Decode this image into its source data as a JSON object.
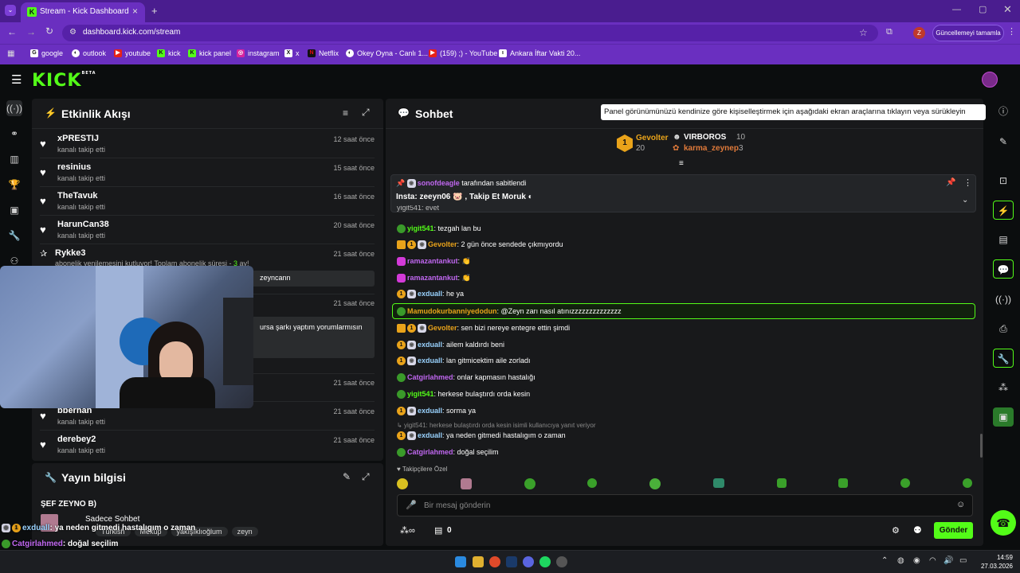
{
  "browser": {
    "tab_title": "Stream - Kick Dashboard",
    "url": "dashboard.kick.com/stream",
    "update_label": "Güncellemeyi tamamla",
    "profile_initial": "Z",
    "bookmarks": [
      "google",
      "outlook",
      "youtube",
      "kick",
      "kick panel",
      "instagram",
      "x",
      "Netflix",
      "Okey Oyna - Canlı 1...",
      "(159) ;) - YouTube",
      "Ankara İftar Vakti 20..."
    ]
  },
  "kick": {
    "logo": "KICK",
    "logo_sup": "BETA"
  },
  "activity": {
    "title": "Etkinlik Akışı",
    "rows": [
      {
        "name": "xPRESTIJ",
        "sub": "kanalı takip etti",
        "time": "12 saat önce"
      },
      {
        "name": "resinius",
        "sub": "kanalı takip etti",
        "time": "15 saat önce"
      },
      {
        "name": "TheTavuk",
        "sub": "kanalı takip etti",
        "time": "16 saat önce"
      },
      {
        "name": "HarunCan38",
        "sub": "kanalı takip etti",
        "time": "20 saat önce"
      }
    ],
    "sub_row": {
      "name": "Rykke3",
      "sub": "abonelik yenilemesini kutluyor! Toplam abonelik süresi - ",
      "months": "3",
      "months_suffix": " ay!",
      "time": "21 saat önce",
      "highlight": "zeyncann"
    },
    "hidden_row": {
      "time": "21 saat önce",
      "text": "ursa şarkı yaptım yorumlarmısın"
    },
    "row_5_time": "21 saat önce",
    "lower_rows": [
      {
        "name": "bberhan",
        "sub": "kanalı takip etti",
        "time": "21 saat önce"
      },
      {
        "name": "derebey2",
        "sub": "kanalı takip etti",
        "time": "21 saat önce"
      }
    ]
  },
  "stream_info": {
    "title": "Yayın bilgisi",
    "stream_title": "ŞEF ZEYNO B)",
    "category": "Sadece Sohbet",
    "tags": [
      "Türkish",
      "Meküp",
      "yakışıklıoğlum",
      "zeyn"
    ]
  },
  "overlay_chat": [
    {
      "user": "exduall",
      "text": ": ya neden gitmedi hastalıgım o zaman"
    },
    {
      "user": "Catgirlahmed",
      "text": ": doğal seçilim"
    }
  ],
  "chat": {
    "title": "Sohbet",
    "tooltip": "Panel görünümünüzü kendinize göre kişiselleştirmek için aşağıdaki ekran araçlarına tıklayın veya sürükleyin",
    "leaderboard": [
      {
        "rank": "1",
        "name": "Gevolter",
        "count": "20"
      },
      {
        "name": "VIRBOROS",
        "count": "10"
      },
      {
        "name": "karma_zeynep",
        "count": "3"
      }
    ],
    "pinned_by": "sonofdeagle",
    "pinned_label": "tarafından sabitlendi",
    "pinned_text": "Insta: zeeyn06",
    "pinned_text2": ", Takip Et Moruk",
    "cut_text": "yigit541: evet",
    "messages": [
      {
        "user": "yigit541",
        "color": "#53fc18",
        "text": ": tezgah lan bu"
      },
      {
        "user": "Gevolter",
        "color": "#e9a31a",
        "text": ": 2 gün önce sendede çıkmıyordu"
      },
      {
        "user": "ramazantankut",
        "color": "#c067f0",
        "text": ": 👏"
      },
      {
        "user": "ramazantankut",
        "color": "#c067f0",
        "text": ": 👏"
      },
      {
        "user": "exduall",
        "color": "#9ad3ff",
        "text": ": he ya"
      },
      {
        "user": "Mamudokurbanniyedodun",
        "color": "#e9a31a",
        "text": ": @Zeyn zarı nasıl atınızzzzzzzzzzzzzz"
      },
      {
        "user": "Gevolter",
        "color": "#e9a31a",
        "text": ": sen bizi nereye entegre ettin şimdi"
      },
      {
        "user": "exduall",
        "color": "#9ad3ff",
        "text": ": ailem kaldırdı beni"
      },
      {
        "user": "exduall",
        "color": "#9ad3ff",
        "text": ": lan gitmicektim aile zorladı"
      },
      {
        "user": "Catgirlahmed",
        "color": "#c067f0",
        "text": ": onlar kapmasın hastalığı"
      },
      {
        "user": "yigit541",
        "color": "#53fc18",
        "text": ": herkese bulaştırdı orda kesin"
      },
      {
        "user": "exduall",
        "color": "#9ad3ff",
        "text": ": sorma ya"
      },
      {
        "user": "exduall",
        "color": "#9ad3ff",
        "text": ": ya neden gitmedi hastalıgım o zaman"
      },
      {
        "user": "Catgirlahmed",
        "color": "#c067f0",
        "text": ": doğal seçilim"
      }
    ],
    "reply_hint": "yigit541: herkese bulaştırdı orda kesin isimli kullanıcıya yanıt veriyor",
    "followers_only": "Takipçilere Özel",
    "input_placeholder": "Bir mesaj gönderin",
    "points": "0",
    "send_label": "Gönder"
  },
  "taskbar": {
    "time": "14:59",
    "date": "27.03.2026"
  },
  "colors": {
    "kick_green": "#53fc18",
    "browser_purple": "#6a2fc0"
  }
}
